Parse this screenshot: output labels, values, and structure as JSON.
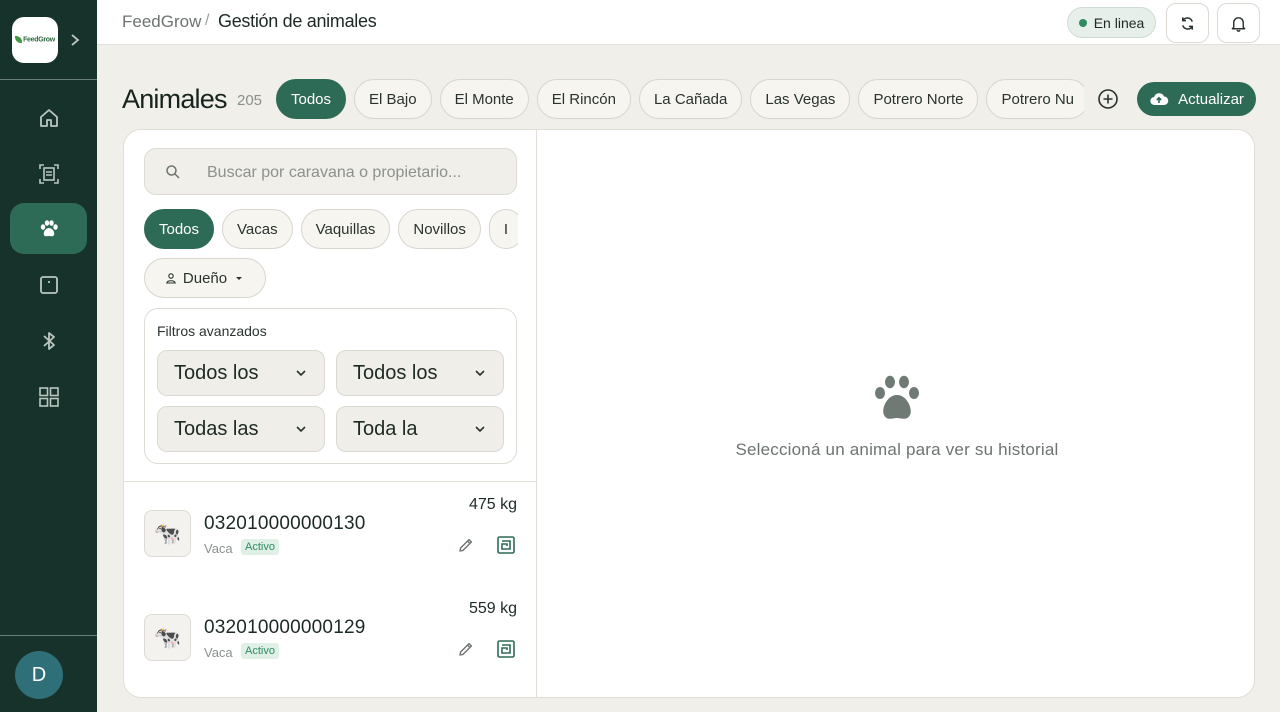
{
  "app": {
    "name": "FeedGrow",
    "logo_text": "FeedGrow"
  },
  "breadcrumb": {
    "root": "FeedGrow",
    "separator": "/",
    "page": "Gestión de animales"
  },
  "status": {
    "label": "En linea",
    "color": "#2e8b62"
  },
  "sidebar": {
    "items": [
      {
        "name": "home",
        "icon": "home-icon"
      },
      {
        "name": "reports",
        "icon": "document-scan-icon"
      },
      {
        "name": "animals",
        "icon": "paw-icon",
        "active": true
      },
      {
        "name": "scale",
        "icon": "scale-icon"
      },
      {
        "name": "bluetooth",
        "icon": "bluetooth-icon"
      },
      {
        "name": "apps",
        "icon": "grid-icon"
      }
    ],
    "user_initial": "D"
  },
  "header": {
    "title": "Animales",
    "count": "205",
    "update_label": "Actualizar"
  },
  "farm_tabs": [
    "Todos",
    "El Bajo",
    "El Monte",
    "El Rincón",
    "La Cañada",
    "Las Vegas",
    "Potrero Norte",
    "Potrero Nu"
  ],
  "search": {
    "placeholder": "Buscar por caravana o propietario..."
  },
  "type_tabs": [
    "Todos",
    "Vacas",
    "Vaquillas",
    "Novillos",
    "I"
  ],
  "owner_filter": "Dueño",
  "advanced": {
    "title": "Filtros avanzados",
    "selects": [
      "Todos los",
      "Todos los",
      "Todas las",
      "Toda la"
    ]
  },
  "animals": [
    {
      "tag": "032010000000130",
      "type": "Vaca",
      "status": "Activo",
      "weight": "475 kg"
    },
    {
      "tag": "032010000000129",
      "type": "Vaca",
      "status": "Activo",
      "weight": "559 kg"
    }
  ],
  "empty_state": "Seleccioná un animal para ver su historial",
  "colors": {
    "sidebar": "#17322a",
    "accent": "#2e6b57",
    "background": "#f1efe9"
  }
}
